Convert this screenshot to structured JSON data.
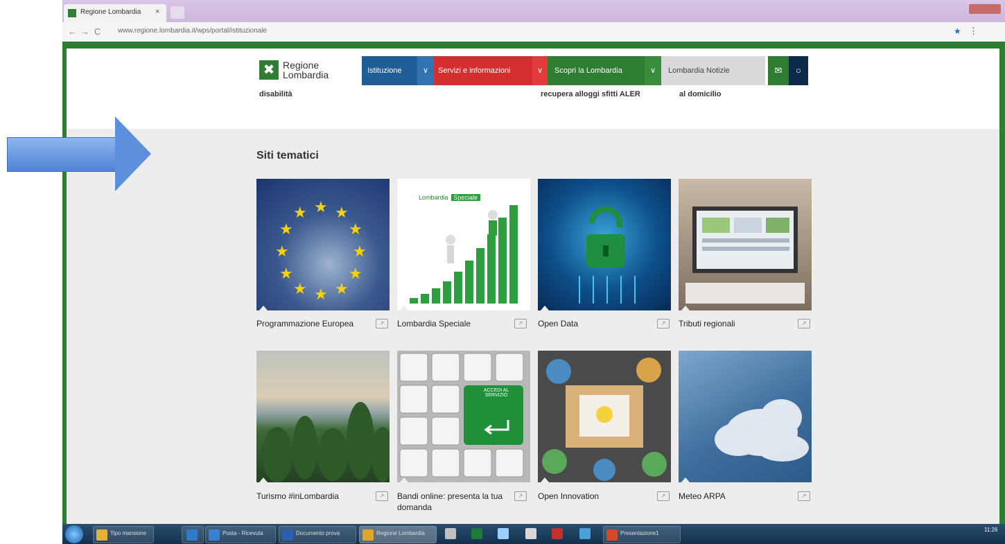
{
  "browser": {
    "tab_title": "Regione Lombardia",
    "tab_close": "×",
    "url": "www.regione.lombardia.it/wps/portal/istituzionale",
    "nav_back": "←",
    "nav_forward": "→",
    "nav_reload": "C",
    "star": "★",
    "menu": "⋮"
  },
  "site": {
    "logo_line1": "Regione",
    "logo_line2": "Lombardia",
    "logo_mark": "✖",
    "nav": {
      "istituzione": "Istituzione",
      "servizi": "Servizi e informazioni",
      "scopri": "Scopri la Lombardia",
      "notizie": "Lombardia Notizie",
      "chevron": "∨",
      "mail_icon": "✉",
      "search_icon": "○"
    },
    "cut_items": [
      "disabilità",
      "recupera alloggi sfitti ALER",
      "al domicilio"
    ]
  },
  "section": {
    "title": "Siti tematici",
    "ext_icon": "↗",
    "tiles": [
      {
        "label": "Programmazione Europea"
      },
      {
        "label": "Lombardia Speciale",
        "badge_left": "Lombardia",
        "badge_right": "Speciale"
      },
      {
        "label": "Open Data"
      },
      {
        "label": "Tributi regionali"
      },
      {
        "label": "Turismo #inLombardia"
      },
      {
        "label": "Bandi online: presenta la tua domanda",
        "key_text": "ACCEDI AL SERVIZIO"
      },
      {
        "label": "Open Innovation"
      },
      {
        "label": "Meteo ARPA"
      }
    ]
  },
  "taskbar": {
    "items": [
      "Tipo mansione",
      "",
      "Posta - Ricevuta",
      "Documento prova",
      "Regione Lombardia",
      "",
      "",
      "",
      "",
      "",
      "Presentazione1"
    ],
    "clock": "11:26"
  },
  "colors": {
    "green": "#2e7d32",
    "blue": "#1f5e97",
    "red": "#d32f2f",
    "grey": "#ededed"
  }
}
